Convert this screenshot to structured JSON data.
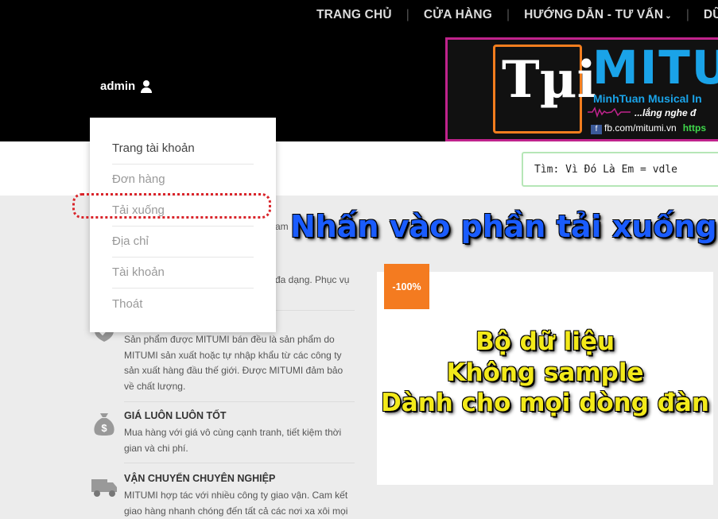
{
  "nav": {
    "items": [
      "TRANG CHỦ",
      "CỬA HÀNG",
      "HƯỚNG DẪN - TƯ VẤN",
      "DỮ L"
    ],
    "chevron": "⌄"
  },
  "account": {
    "username": "admin"
  },
  "banner": {
    "logo_text": "Tµi",
    "brand": "MITUM",
    "subtitle": "MinhTuan Musical In",
    "slogan": "...lắng nghe đ",
    "facebook": "fb.com/mitumi.vn",
    "https": "https"
  },
  "search": {
    "value": "Tìm: Vì Đó Là Em = vdle"
  },
  "dropdown": {
    "items": [
      "Trang tài khoản",
      "Đơn hàng",
      "Tải xuống",
      "Địa chỉ",
      "Tài khoản",
      "Thoát"
    ]
  },
  "annotation": {
    "text": "Nhấn vào phần tải xuống"
  },
  "background_fragments": {
    "am": "am",
    "da_dang": "đa dạng. Phục vụ"
  },
  "features": [
    {
      "title": "",
      "desc": "Sản phẩm được MITUMI bán đều là sản phẩm do MITUMI sản xuất hoặc tự nhập khẩu từ các công ty sản xuất hàng đầu thế giới. Được MITUMI đảm bảo về chất lượng.",
      "icon": "shield-check-icon"
    },
    {
      "title": "GIÁ LUÔN LUÔN TỐT",
      "desc": "Mua hàng với giá vô cùng cạnh tranh, tiết kiệm thời gian và chi phí.",
      "icon": "money-bag-icon"
    },
    {
      "title": "VẬN CHUYỂN CHUYÊN NGHIỆP",
      "desc": "MITUMI hợp tác với nhiều công ty giao vận. Cam kết giao hàng nhanh chóng đến tất cả các nơi xa xôi mọi",
      "icon": "truck-icon"
    }
  ],
  "product": {
    "badge": "-100%",
    "lines": [
      "Bộ dữ liệu",
      "Không sample",
      "Dành cho mọi dòng đàn"
    ]
  },
  "colors": {
    "accent_orange": "#f47b20",
    "highlight_red": "#d9242a",
    "annotation_blue": "#1a5cff",
    "product_text_yellow": "#f3ea1a",
    "brand_blue": "#1aa3e8"
  }
}
